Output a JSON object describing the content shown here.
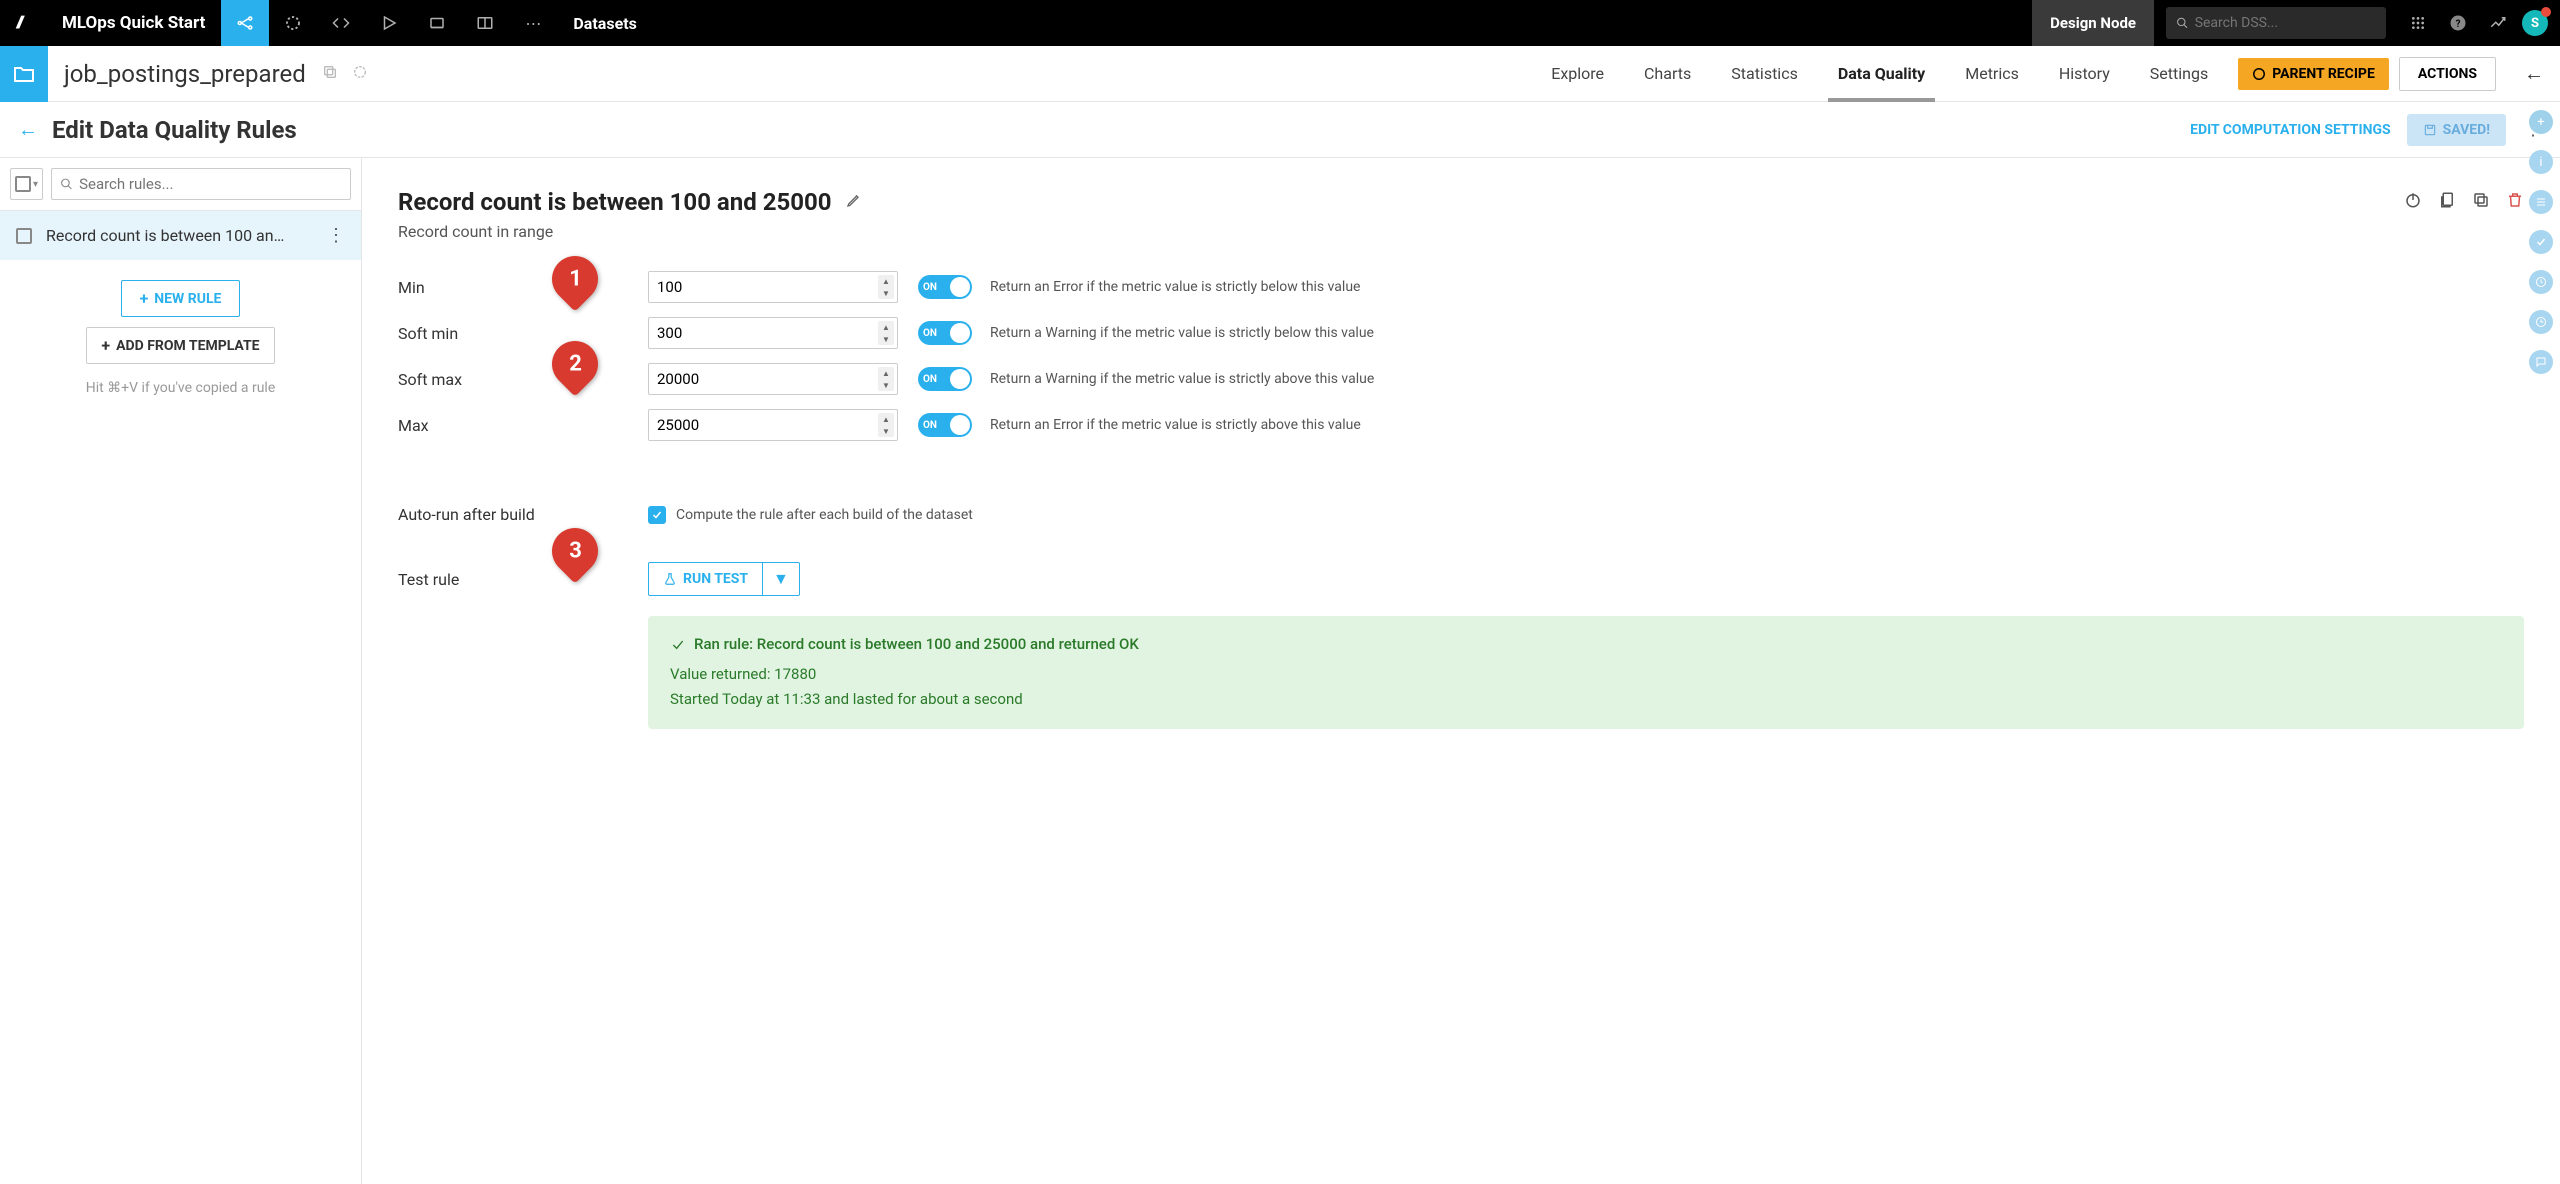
{
  "topbar": {
    "project_name": "MLOps Quick Start",
    "nav_label": "Datasets",
    "design_node": "Design Node",
    "search_placeholder": "Search DSS...",
    "avatar_letter": "S"
  },
  "subnav": {
    "dataset_name": "job_postings_prepared",
    "tabs": {
      "explore": "Explore",
      "charts": "Charts",
      "statistics": "Statistics",
      "data_quality": "Data Quality",
      "metrics": "Metrics",
      "history": "History",
      "settings": "Settings"
    },
    "parent_recipe": "PARENT RECIPE",
    "actions": "ACTIONS"
  },
  "thirdbar": {
    "title": "Edit Data Quality Rules",
    "edit_computation": "EDIT COMPUTATION SETTINGS",
    "saved": "SAVED!"
  },
  "sidebar": {
    "search_placeholder": "Search rules...",
    "rule_item": "Record count is between 100 an…",
    "new_rule": "NEW RULE",
    "add_template": "ADD FROM TEMPLATE",
    "hint": "Hit ⌘+V if you've copied a rule"
  },
  "detail": {
    "title": "Record count is between 100 and 25000",
    "subtitle": "Record count in range",
    "rows": {
      "min": {
        "label": "Min",
        "value": "100",
        "toggle": "ON",
        "desc": "Return an Error if the metric value is strictly below this value"
      },
      "softmin": {
        "label": "Soft min",
        "value": "300",
        "toggle": "ON",
        "desc": "Return a Warning if the metric value is strictly below this value"
      },
      "softmax": {
        "label": "Soft max",
        "value": "20000",
        "toggle": "ON",
        "desc": "Return a Warning if the metric value is strictly above this value"
      },
      "max": {
        "label": "Max",
        "value": "25000",
        "toggle": "ON",
        "desc": "Return an Error if the metric value is strictly above this value"
      }
    },
    "autorun": {
      "label": "Auto-run after build",
      "desc": "Compute the rule after each build of the dataset"
    },
    "testrule": {
      "label": "Test rule",
      "button": "RUN TEST"
    },
    "result": {
      "line1": "Ran rule: Record count is between 100 and 25000 and returned OK",
      "line2": "Value returned: 17880",
      "line3": "Started Today at 11:33 and lasted for about a second"
    }
  },
  "annotations": {
    "a1": "1",
    "a2": "2",
    "a3": "3"
  }
}
